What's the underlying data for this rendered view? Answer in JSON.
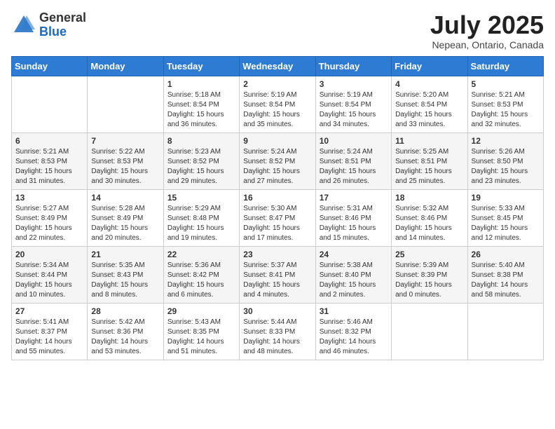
{
  "header": {
    "logo_general": "General",
    "logo_blue": "Blue",
    "month": "July 2025",
    "location": "Nepean, Ontario, Canada"
  },
  "weekdays": [
    "Sunday",
    "Monday",
    "Tuesday",
    "Wednesday",
    "Thursday",
    "Friday",
    "Saturday"
  ],
  "weeks": [
    [
      {
        "day": "",
        "info": ""
      },
      {
        "day": "",
        "info": ""
      },
      {
        "day": "1",
        "info": "Sunrise: 5:18 AM\nSunset: 8:54 PM\nDaylight: 15 hours\nand 36 minutes."
      },
      {
        "day": "2",
        "info": "Sunrise: 5:19 AM\nSunset: 8:54 PM\nDaylight: 15 hours\nand 35 minutes."
      },
      {
        "day": "3",
        "info": "Sunrise: 5:19 AM\nSunset: 8:54 PM\nDaylight: 15 hours\nand 34 minutes."
      },
      {
        "day": "4",
        "info": "Sunrise: 5:20 AM\nSunset: 8:54 PM\nDaylight: 15 hours\nand 33 minutes."
      },
      {
        "day": "5",
        "info": "Sunrise: 5:21 AM\nSunset: 8:53 PM\nDaylight: 15 hours\nand 32 minutes."
      }
    ],
    [
      {
        "day": "6",
        "info": "Sunrise: 5:21 AM\nSunset: 8:53 PM\nDaylight: 15 hours\nand 31 minutes."
      },
      {
        "day": "7",
        "info": "Sunrise: 5:22 AM\nSunset: 8:53 PM\nDaylight: 15 hours\nand 30 minutes."
      },
      {
        "day": "8",
        "info": "Sunrise: 5:23 AM\nSunset: 8:52 PM\nDaylight: 15 hours\nand 29 minutes."
      },
      {
        "day": "9",
        "info": "Sunrise: 5:24 AM\nSunset: 8:52 PM\nDaylight: 15 hours\nand 27 minutes."
      },
      {
        "day": "10",
        "info": "Sunrise: 5:24 AM\nSunset: 8:51 PM\nDaylight: 15 hours\nand 26 minutes."
      },
      {
        "day": "11",
        "info": "Sunrise: 5:25 AM\nSunset: 8:51 PM\nDaylight: 15 hours\nand 25 minutes."
      },
      {
        "day": "12",
        "info": "Sunrise: 5:26 AM\nSunset: 8:50 PM\nDaylight: 15 hours\nand 23 minutes."
      }
    ],
    [
      {
        "day": "13",
        "info": "Sunrise: 5:27 AM\nSunset: 8:49 PM\nDaylight: 15 hours\nand 22 minutes."
      },
      {
        "day": "14",
        "info": "Sunrise: 5:28 AM\nSunset: 8:49 PM\nDaylight: 15 hours\nand 20 minutes."
      },
      {
        "day": "15",
        "info": "Sunrise: 5:29 AM\nSunset: 8:48 PM\nDaylight: 15 hours\nand 19 minutes."
      },
      {
        "day": "16",
        "info": "Sunrise: 5:30 AM\nSunset: 8:47 PM\nDaylight: 15 hours\nand 17 minutes."
      },
      {
        "day": "17",
        "info": "Sunrise: 5:31 AM\nSunset: 8:46 PM\nDaylight: 15 hours\nand 15 minutes."
      },
      {
        "day": "18",
        "info": "Sunrise: 5:32 AM\nSunset: 8:46 PM\nDaylight: 15 hours\nand 14 minutes."
      },
      {
        "day": "19",
        "info": "Sunrise: 5:33 AM\nSunset: 8:45 PM\nDaylight: 15 hours\nand 12 minutes."
      }
    ],
    [
      {
        "day": "20",
        "info": "Sunrise: 5:34 AM\nSunset: 8:44 PM\nDaylight: 15 hours\nand 10 minutes."
      },
      {
        "day": "21",
        "info": "Sunrise: 5:35 AM\nSunset: 8:43 PM\nDaylight: 15 hours\nand 8 minutes."
      },
      {
        "day": "22",
        "info": "Sunrise: 5:36 AM\nSunset: 8:42 PM\nDaylight: 15 hours\nand 6 minutes."
      },
      {
        "day": "23",
        "info": "Sunrise: 5:37 AM\nSunset: 8:41 PM\nDaylight: 15 hours\nand 4 minutes."
      },
      {
        "day": "24",
        "info": "Sunrise: 5:38 AM\nSunset: 8:40 PM\nDaylight: 15 hours\nand 2 minutes."
      },
      {
        "day": "25",
        "info": "Sunrise: 5:39 AM\nSunset: 8:39 PM\nDaylight: 15 hours\nand 0 minutes."
      },
      {
        "day": "26",
        "info": "Sunrise: 5:40 AM\nSunset: 8:38 PM\nDaylight: 14 hours\nand 58 minutes."
      }
    ],
    [
      {
        "day": "27",
        "info": "Sunrise: 5:41 AM\nSunset: 8:37 PM\nDaylight: 14 hours\nand 55 minutes."
      },
      {
        "day": "28",
        "info": "Sunrise: 5:42 AM\nSunset: 8:36 PM\nDaylight: 14 hours\nand 53 minutes."
      },
      {
        "day": "29",
        "info": "Sunrise: 5:43 AM\nSunset: 8:35 PM\nDaylight: 14 hours\nand 51 minutes."
      },
      {
        "day": "30",
        "info": "Sunrise: 5:44 AM\nSunset: 8:33 PM\nDaylight: 14 hours\nand 48 minutes."
      },
      {
        "day": "31",
        "info": "Sunrise: 5:46 AM\nSunset: 8:32 PM\nDaylight: 14 hours\nand 46 minutes."
      },
      {
        "day": "",
        "info": ""
      },
      {
        "day": "",
        "info": ""
      }
    ]
  ]
}
